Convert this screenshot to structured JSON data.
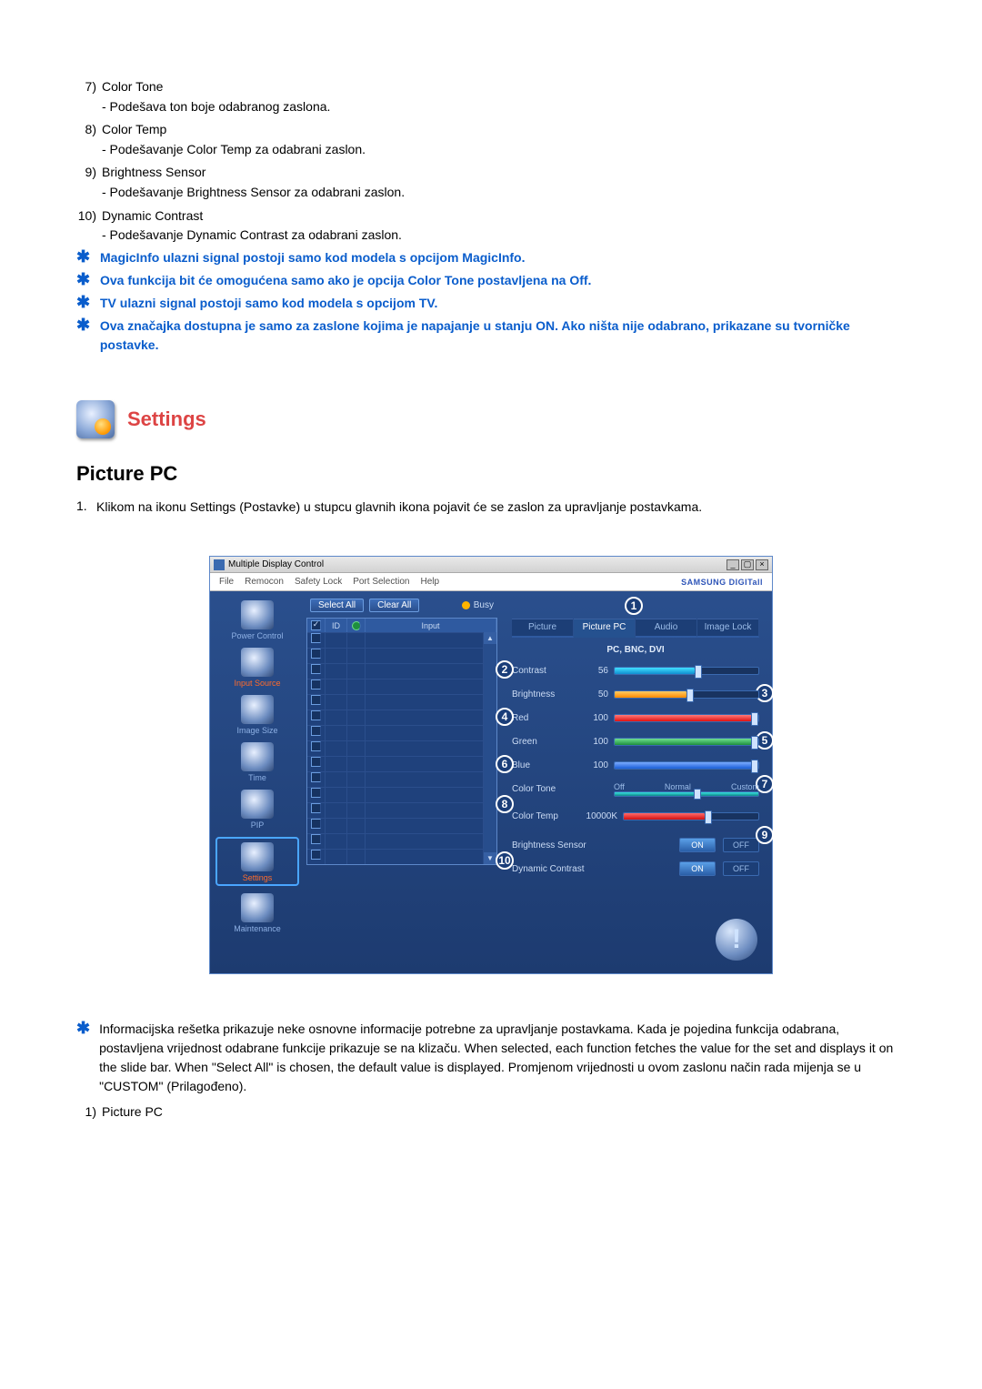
{
  "list": {
    "i7": {
      "num": "7)",
      "title": "Color Tone",
      "desc": "- Podešava ton boje odabranog zaslona."
    },
    "i8": {
      "num": "8)",
      "title": "Color Temp",
      "desc": "- Podešavanje Color Temp za odabrani zaslon."
    },
    "i9": {
      "num": "9)",
      "title": "Brightness Sensor",
      "desc": "- Podešavanje Brightness Sensor za odabrani zaslon."
    },
    "i10": {
      "num": "10)",
      "title": "Dynamic Contrast",
      "desc": "- Podešavanje Dynamic Contrast za odabrani zaslon."
    }
  },
  "notes": {
    "n1": "MagicInfo ulazni signal postoji samo kod modela s opcijom MagicInfo.",
    "n2": "Ova funkcija bit će omogućena samo ako je opcija Color Tone postavljena na Off.",
    "n3": "TV ulazni signal postoji samo kod modela s opcijom TV.",
    "n4": "Ova značajka dostupna je samo za zaslone kojima je napajanje u stanju ON. Ako ništa nije odabrano, prikazane su tvorničke postavke."
  },
  "headings": {
    "settings": "Settings",
    "picturepc": "Picture PC"
  },
  "para1": "Klikom na ikonu Settings (Postavke) u stupcu glavnih ikona pojavit će se zaslon za upravljanje postavkama.",
  "footer_note": "Informacijska rešetka prikazuje neke osnovne informacije potrebne za upravljanje postavkama. Kada je pojedina funkcija odabrana, postavljena vrijednost odabrane funkcije prikazuje se na klizaču. When selected, each function fetches the value for the set and displays it on the slide bar. When \"Select All\" is chosen, the default value is displayed. Promjenom vrijednosti u ovom zaslonu način rada mijenja se u \"CUSTOM\" (Prilagođeno).",
  "footer_item": {
    "num": "1)",
    "title": "Picture PC"
  },
  "app": {
    "title": "Multiple Display Control",
    "menu": {
      "file": "File",
      "remocon": "Remocon",
      "safety": "Safety Lock",
      "port": "Port Selection",
      "help": "Help"
    },
    "brand": "SAMSUNG DIGITall",
    "sidebar": {
      "power": "Power Control",
      "input": "Input Source",
      "image": "Image Size",
      "time": "Time",
      "pip": "PIP",
      "settings": "Settings",
      "maint": "Maintenance"
    },
    "buttons": {
      "select": "Select All",
      "clear": "Clear All",
      "busy": "Busy"
    },
    "grid": {
      "h2": "ID",
      "h4": "Input"
    },
    "tabs": {
      "picture": "Picture",
      "picturepc": "Picture PC",
      "audio": "Audio",
      "imagelock": "Image Lock"
    },
    "mode": "PC, BNC, DVI",
    "rows": {
      "contrast": {
        "label": "Contrast",
        "val": "56"
      },
      "brightness": {
        "label": "Brightness",
        "val": "50"
      },
      "red": {
        "label": "Red",
        "val": "100"
      },
      "green": {
        "label": "Green",
        "val": "100"
      },
      "blue": {
        "label": "Blue",
        "val": "100"
      },
      "colortone": {
        "label": "Color Tone",
        "opts": {
          "off": "Off",
          "normal": "Normal",
          "custom": "Custom"
        }
      },
      "colortemp": {
        "label": "Color Temp",
        "val": "10000K"
      },
      "bsensor": {
        "label": "Brightness Sensor"
      },
      "dcontrast": {
        "label": "Dynamic Contrast"
      }
    },
    "onoff": {
      "on": "ON",
      "off": "OFF"
    },
    "callouts": {
      "c1": "1",
      "c2": "2",
      "c3": "3",
      "c4": "4",
      "c5": "5",
      "c6": "6",
      "c7": "7",
      "c8": "8",
      "c9": "9",
      "c10": "10"
    }
  },
  "para_prefix": "1."
}
